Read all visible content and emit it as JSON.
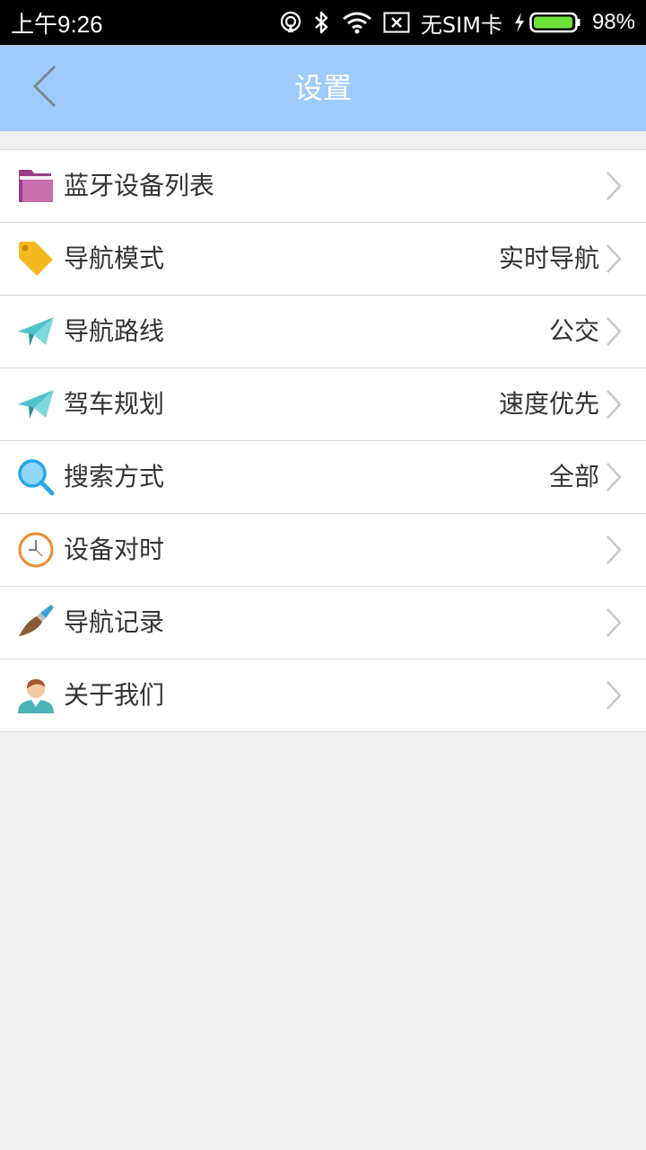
{
  "status_bar": {
    "time": "上午9:26",
    "sim_text": "无SIM卡",
    "battery_percent": "98%",
    "battery_level": 0.98,
    "icons": [
      "hotspot-icon",
      "bluetooth-icon",
      "wifi-icon",
      "no-sim-icon",
      "charging-icon",
      "battery-icon"
    ]
  },
  "header": {
    "title": "设置",
    "background": "#9ecbfb",
    "back_icon": "chevron-left-icon"
  },
  "settings": {
    "items": [
      {
        "label": "蓝牙设备列表",
        "value": "",
        "icon": "folder-icon"
      },
      {
        "label": "导航模式",
        "value": "实时导航",
        "icon": "tag-icon"
      },
      {
        "label": "导航路线",
        "value": "公交",
        "icon": "paper-plane-icon"
      },
      {
        "label": "驾车规划",
        "value": "速度优先",
        "icon": "paper-plane-icon"
      },
      {
        "label": "搜索方式",
        "value": "全部",
        "icon": "search-icon"
      },
      {
        "label": "设备对时",
        "value": "",
        "icon": "clock-icon"
      },
      {
        "label": "导航记录",
        "value": "",
        "icon": "brush-icon"
      },
      {
        "label": "关于我们",
        "value": "",
        "icon": "user-icon"
      }
    ]
  },
  "colors": {
    "battery_fill": "#6ee23b",
    "divider": "#d8d8d8",
    "chevron": "#c8c8c8"
  }
}
